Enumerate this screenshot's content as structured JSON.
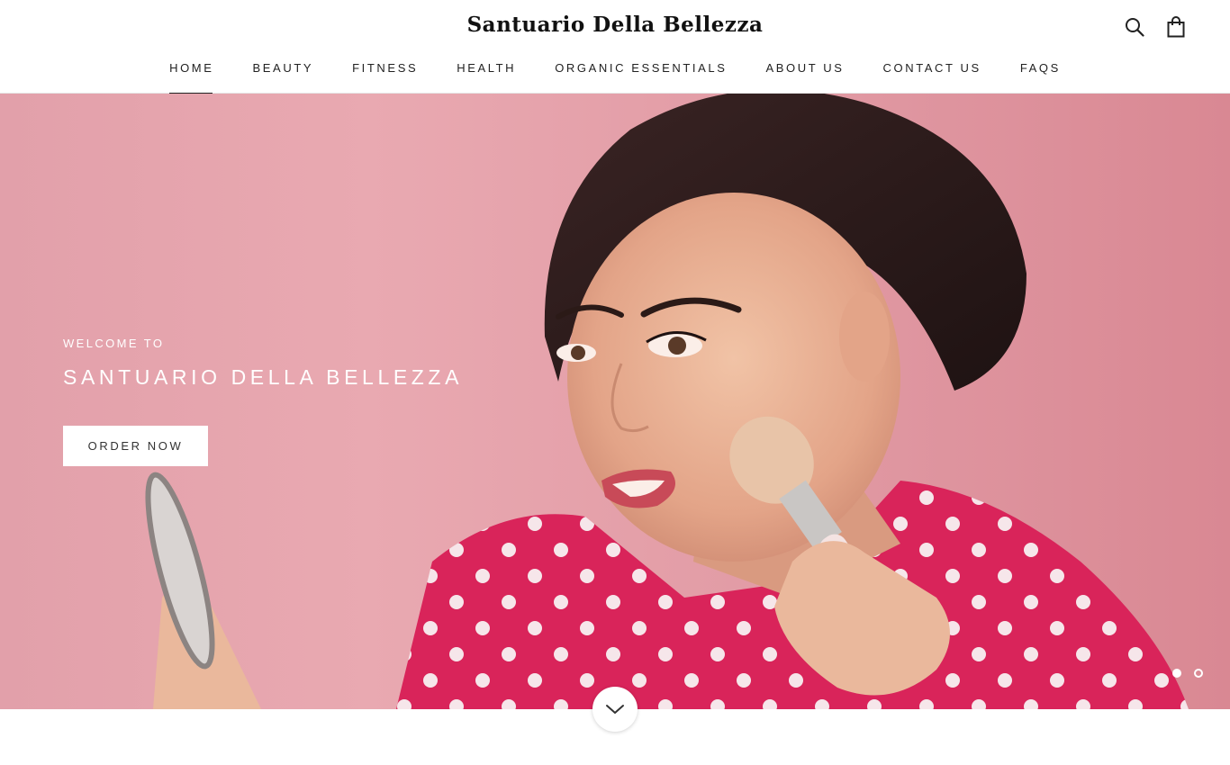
{
  "brand": {
    "name": "Santuario Della Bellezza"
  },
  "nav": {
    "items": [
      {
        "label": "HOME",
        "active": true
      },
      {
        "label": "BEAUTY",
        "active": false
      },
      {
        "label": "FITNESS",
        "active": false
      },
      {
        "label": "HEALTH",
        "active": false
      },
      {
        "label": "ORGANIC ESSENTIALS",
        "active": false
      },
      {
        "label": "ABOUT US",
        "active": false
      },
      {
        "label": "CONTACT US",
        "active": false
      },
      {
        "label": "FAQS",
        "active": false
      }
    ]
  },
  "header_icons": {
    "search": "search-icon",
    "cart": "shopping-bag-icon"
  },
  "hero": {
    "kicker": "WELCOME TO",
    "title": "SANTUARIO DELLA BELLEZZA",
    "button_label": "ORDER NOW",
    "slide_count": 2,
    "active_slide": 1
  },
  "scroll_icon": "chevron-down-icon",
  "colors": {
    "hero_background": "#e6a4ad",
    "accent_text": "#ffffff",
    "nav_text": "#222222"
  }
}
